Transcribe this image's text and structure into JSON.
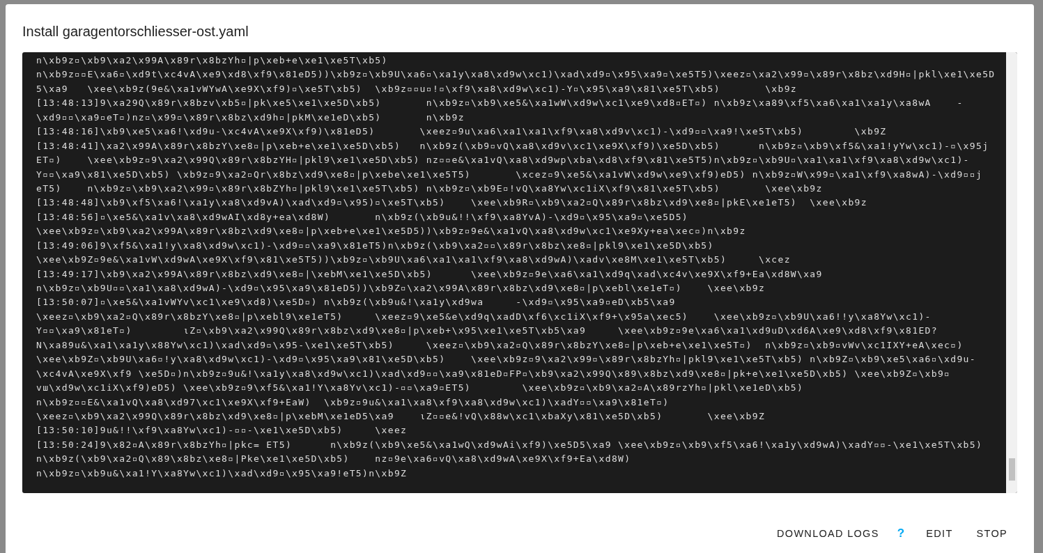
{
  "dialog": {
    "title": "Install garagentorschliesser-ost.yaml",
    "log_lines": [
      "n\\xb9z▫\\xb9\\xa2\\x99A\\x89r\\x8bzYh▫|p\\xeb+e\\xe1\\xe5T\\xb5)",
      "n\\xb9z▫▫E\\xa6▫\\xd9t\\xc4vA\\xe9\\xd8\\xf9\\x81eD5))\\xb9z▫\\xb9U\\xa6▫\\xa1y\\xa8\\xd9w\\xc1)\\xad\\xd9▫\\x95\\xa9▫\\xe5T5)\\xeez▫\\xa2\\x99▫\\x89r\\x8bz\\xd9H▫|pkl\\xe1\\xe5D",
      "5\\xa9   \\xee\\xb9z(9e&\\xa1vWYwA\\xe9X\\xf9)▫\\xe5T\\xb5)  \\xb9z▫▫u▫!▫\\xf9\\xa8\\xd9w\\xc1)-Y▫\\x95\\xa9\\x81\\xe5T\\xb5)       \\xb9z",
      "[13:48:13]9\\xa29Q\\x89r\\x8bzv\\xb5▫|pk\\xe5\\xe1\\xe5D\\xb5)       n\\xb9z▫\\xb9\\xe5&\\xa1wW\\xd9w\\xc1\\xe9\\xd8▫ET▫) n\\xb9z\\xa89\\xf5\\xa6\\xa1\\xa1y\\xa8wA    -",
      "\\xd9▫▫\\xa9▫eT▫)nz▫\\x99▫\\x89r\\x8bz\\xd9h▫|pkM\\xe1eD\\xb5)       n\\xb9z",
      "[13:48:16]\\xb9\\xe5\\xa6!\\xd9u-\\xc4vA\\xe9X\\xf9)\\x81eD5)       \\xeez▫9u\\xa6\\xa1\\xa1\\xf9\\xa8\\xd9v\\xc1)-\\xd9▫▫\\xa9!\\xe5T\\xb5)        \\xb9Z",
      "[13:48:41]\\xa2\\x99A\\x89r\\x8bzY\\xe8▫|p\\xeb+e\\xe1\\xe5D\\xb5)   n\\xb9z(\\xb9▫vQ\\xa8\\xd9v\\xc1\\xe9X\\xf9)\\xe5D\\xb5)      n\\xb9z▫\\xb9\\xf5&\\xa1!yYw\\xc1)-▫\\x95j",
      "ET▫)    \\xee\\xb9z▫9\\xa2\\x99Q\\x89r\\x8bzYH▫|pkl9\\xe1\\xe5D\\xb5) nz▫▫e&\\xa1vQ\\xa8\\xd9wp\\xba\\xd8\\xf9\\x81\\xe5T5)n\\xb9z▫\\xb9U▫\\xa1\\xa1\\xf9\\xa8\\xd9w\\xc1)-",
      "Y▫▫\\xa9\\x81\\xe5D\\xb5) \\xb9z▫9\\xa2▫Qr\\x8bz\\xd9\\xe8▫|p\\xebe\\xe1\\xe5T5)       \\xcez▫9\\xe5&\\xa1vW\\xd9w\\xe9\\xf9)eD5) n\\xb9z▫W\\x99▫\\xa1\\xf9\\xa8wA)-\\xd9▫▫j",
      "eT5)    n\\xb9z▫\\xb9\\xa2\\x99▫\\x89r\\x8bZYh▫|pkl9\\xe1\\xe5T\\xb5) n\\xb9z▫\\xb9E▫!vQ\\xa8Yw\\xc1iX\\xf9\\x81\\xe5T\\xb5)       \\xee\\xb9z",
      "[13:48:48]\\xb9\\xf5\\xa6!\\xa1y\\xa8\\xd9vA)\\xad\\xd9▫\\x95)▫\\xe5T\\xb5)    \\xee\\xb9R▫\\xb9\\xa2▫Q\\x89r\\x8bz\\xd9\\xe8▫|pkE\\xe1eT5)  \\xee\\xb9z",
      "[13:48:56]▫\\xe5&\\xa1v\\xa8\\xd9wAI\\xd8y+ea\\xd8W)       n\\xb9z(\\xb9u&!!\\xf9\\xa8YvA)-\\xd9▫\\x95\\xa9▫\\xe5D5)",
      "\\xee\\xb9z▫\\xb9\\xa2\\x99A\\x89r\\x8bz\\xd9\\xe8▫|p\\xeb+e\\xe1\\xe5D5))\\xb9z▫9e&\\xa1vQ\\xa8\\xd9w\\xc1\\xe9Xy+ea\\xec▫)n\\xb9z",
      "[13:49:06]9\\xf5&\\xa1!y\\xa8\\xd9w\\xc1)-\\xd9▫▫\\xa9\\x81eT5)n\\xb9z(\\xb9\\xa2▫▫\\x89r\\x8bz\\xe8▫|pkl9\\xe1\\xe5D\\xb5)",
      "\\xee\\xb9Z▫9e&\\xa1vW\\xd9wA\\xe9X\\xf9\\x81\\xe5T5))\\xb9z▫\\xb9U\\xa6\\xa1\\xa1\\xf9\\xa8\\xd9wA)\\xadv\\xe8M\\xe1\\xe5T\\xb5)     \\xcez",
      "[13:49:17]\\xb9\\xa2\\x99A\\x89r\\x8bz\\xd9\\xe8▫|\\xebM\\xe1\\xe5D\\xb5)      \\xee\\xb9z▫9e\\xa6\\xa1\\xd9q\\xad\\xc4v\\xe9X\\xf9+Ea\\xd8W\\xa9",
      "n\\xb9z▫\\xb9U▫▫\\xa1\\xa8\\xd9wA)-\\xd9▫\\x95\\xa9\\x81eD5))\\xb9Z▫\\xa2\\x99A\\x89r\\x8bz\\xd9\\xe8▫|p\\xebl\\xe1eT▫)    \\xee\\xb9z",
      "[13:50:07]▫\\xe5&\\xa1vWYv\\xc1\\xe9\\xd8)\\xe5D▫) n\\xb9z(\\xb9u&!\\xa1y\\xd9wa     -\\xd9▫\\x95\\xa9▫eD\\xb5\\xa9",
      "\\xeez▫\\xb9\\xa2▫Q\\x89r\\x8bzY\\xe8▫|p\\xebl9\\xe1eT5)     \\xeez▫9\\xe5&e\\xd9q\\xadD\\xf6\\xc1iX\\xf9+\\x95a\\xec5)    \\xee\\xb9z▫\\xb9U\\xa6!!y\\xa8Yw\\xc1)-",
      "Y▫▫\\xa9\\x81eT▫)        ιZ▫\\xb9\\xa2\\x99Q\\x89r\\x8bz\\xd9\\xe8▫|p\\xeb+\\x95\\xe1\\xe5T\\xb5\\xa9     \\xee\\xb9z▫9e\\xa6\\xa1\\xd9uD\\xd6A\\xe9\\xd8\\xf9\\x81ED?",
      "N\\xa89u&\\xa1\\xa1y\\x88Yw\\xc1)\\xad\\xd9▫\\x95-\\xe1\\xe5T\\xb5)     \\xeez▫\\xb9\\xa2▫Q\\x89r\\x8bzY\\xe8▫|p\\xeb+e\\xe1\\xe5T▫)  n\\xb9z▫\\xb9▫vWv\\xc1IXY+eA\\xec▫)",
      "\\xee\\xb9Z▫\\xb9U\\xa6▫!y\\xa8\\xd9w\\xc1)-\\xd9▫\\x95\\xa9\\x81\\xe5D\\xb5)    \\xee\\xb9z▫9\\xa2\\x99▫\\x89r\\x8bzYh▫|pkl9\\xe1\\xe5T\\xb5) n\\xb9Z▫\\xb9\\xe5\\xa6▫\\xd9u-",
      "\\xc4vA\\xe9X\\xf9 \\xe5D▫)n\\xb9z▫9u&!\\xa1y\\xa8\\xd9w\\xc1)\\xad\\xd9▫▫\\xa9\\x81eD▫FP▫\\xb9\\xa2\\x99Q\\x89\\x8bz\\xd9\\xe8▫|pk+e\\xe1\\xe5D\\xb5) \\xee\\xb9Z▫\\xb9▫",
      "vш\\xd9w\\xc1iX\\xf9)eD5) \\xee\\xb9z▫9\\xf5&\\xa1!Y\\xa8Yv\\xc1)-▫▫\\xa9▫ET5)        \\xee\\xb9z▫\\xb9\\xa2▫A\\x89rzYh▫|pkl\\xe1eD\\xb5)",
      "n\\xb9z▫▫E&\\xa1vQ\\xa8\\xd97\\xc1\\xe9X\\xf9+EaW)  \\xb9z▫9u&\\xa1\\xa8\\xf9\\xa8\\xd9w\\xc1)\\xadY▫▫\\xa9\\x81eT▫)",
      "\\xeez▫\\xb9\\xa2\\x99Q\\x89r\\x8bz\\xd9\\xe8▫|p\\xebM\\xe1eD5\\xa9    ιZ▫▫e&!vQ\\x88w\\xc1\\xbaXy\\x81\\xe5D\\xb5)       \\xee\\xb9Z",
      "[13:50:10]9u&!!\\xf9\\xa8Yw\\xc1)-▫▫-\\xe1\\xe5D\\xb5)     \\xeez",
      "[13:50:24]9\\x82▫A\\x89r\\x8bzYh▫|pkc= ET5)      n\\xb9z(\\xb9\\xe5&\\xa1wQ\\xd9wAi\\xf9)\\xe5D5\\xa9 \\xee\\xb9z▫\\xb9\\xf5\\xa6!\\xa1y\\xd9wA)\\xadY▫▫-\\xe1\\xe5T\\xb5)",
      "n\\xb9z(\\xb9\\xa2▫Q\\x89\\x8bz\\xe8▫|Pke\\xe1\\xe5D\\xb5)    nz▫9e\\xa6▫vQ\\xa8\\xd9wA\\xe9X\\xf9+Ea\\xd8W)",
      "n\\xb9z▫\\xb9u&\\xa1!Y\\xa8Yw\\xc1)\\xad\\xd9▫\\x95\\xa9!eT5)n\\xb9Z"
    ],
    "actions": [
      {
        "label": "DOWNLOAD LOGS",
        "kind": "text"
      },
      {
        "label": "?",
        "kind": "help"
      },
      {
        "label": "EDIT",
        "kind": "text"
      },
      {
        "label": "STOP",
        "kind": "text"
      }
    ]
  }
}
